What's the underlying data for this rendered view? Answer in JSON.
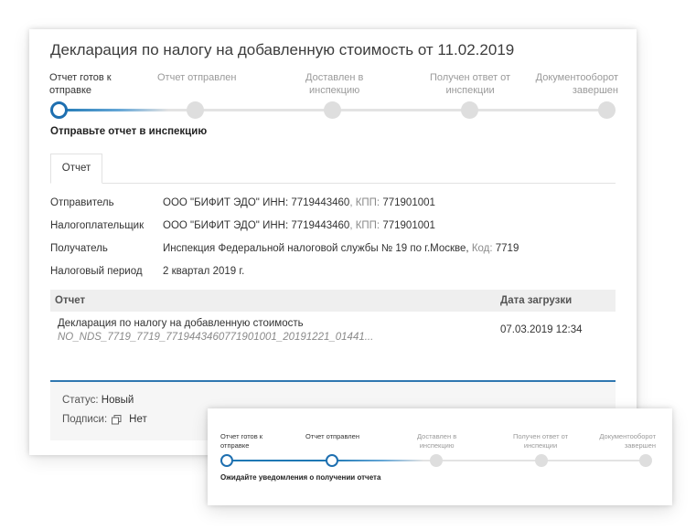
{
  "title": "Декларация по налогу на добавленную стоимость от 11.02.2019",
  "steps": [
    {
      "label": "Отчет готов к отправке"
    },
    {
      "label": "Отчет отправлен"
    },
    {
      "label": "Доставлен в инспекцию"
    },
    {
      "label": "Получен ответ от инспекции"
    },
    {
      "label": "Документооборот завершен"
    }
  ],
  "step_label_lines": {
    "s0": [
      "Отчет готов к",
      "отправке"
    ],
    "s1": [
      "Отчет отправлен"
    ],
    "s2": [
      "Доставлен в",
      "инспекцию"
    ],
    "s3": [
      "Получен ответ от",
      "инспекции"
    ],
    "s4": [
      "Документооборот",
      "завершен"
    ]
  },
  "hint": "Отправьте отчет в инспекцию",
  "tab": "Отчет",
  "info": {
    "sender_label": "Отправитель",
    "sender_name": "ООО \"БИФИТ ЭДО\"",
    "sender_inn_label": "ИНН:",
    "sender_inn": "7719443460",
    "sender_kpp_label": ", КПП:",
    "sender_kpp": "771901001",
    "payer_label": "Налогоплательщик",
    "payer_name": "ООО \"БИФИТ ЭДО\"",
    "payer_inn_label": "ИНН:",
    "payer_inn": "7719443460",
    "payer_kpp_label": ", КПП:",
    "payer_kpp": "771901001",
    "recipient_label": "Получатель",
    "recipient_name": "Инспекция Федеральной налоговой службы № 19 по г.Москве,",
    "recipient_code_label": "Код:",
    "recipient_code": "7719",
    "period_label": "Налоговый период",
    "period_value": "2 квартал 2019 г."
  },
  "table": {
    "col_report": "Отчет",
    "col_date": "Дата загрузки",
    "row_name": "Декларация по налогу на добавленную стоимость",
    "row_file": "NO_NDS_7719_7719_7719443460771901001_20191221_01441...",
    "row_date": "07.03.2019 12:34"
  },
  "footer": {
    "status_label": "Статус:",
    "status_value": "Новый",
    "signs_label": "Подписи:",
    "signs_value": "Нет"
  },
  "popup": {
    "hint": "Ожидайте уведомления о получении отчета"
  },
  "colors": {
    "accent": "#1e6fb0",
    "track": "#e3e3e3",
    "table_header": "#efefef"
  },
  "icons": [
    "copy-icon"
  ]
}
